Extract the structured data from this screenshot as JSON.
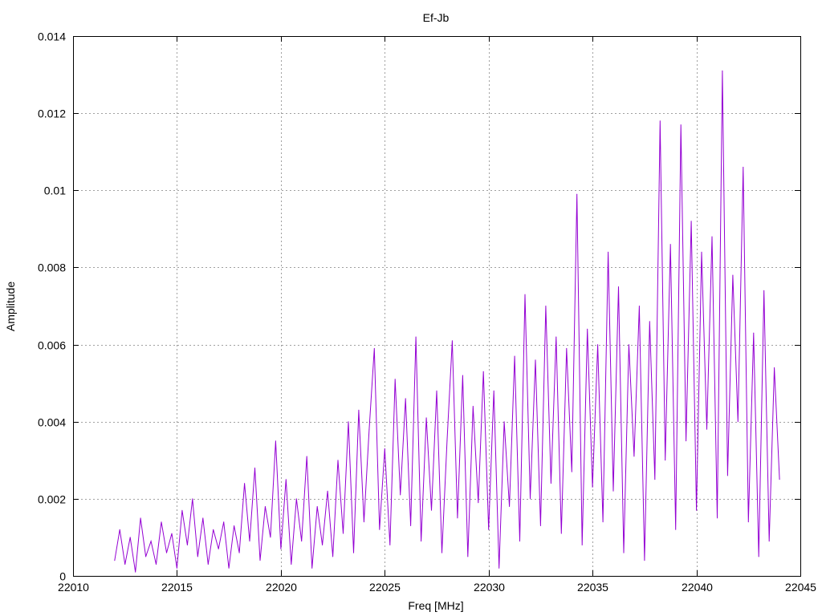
{
  "chart_data": {
    "type": "line",
    "title": "Ef-Jb",
    "xlabel": "Freq [MHz]",
    "ylabel": "Amplitude",
    "xlim": [
      22010,
      22045
    ],
    "ylim": [
      0,
      0.014
    ],
    "grid": true,
    "xticks": [
      22010,
      22015,
      22020,
      22025,
      22030,
      22035,
      22040,
      22045
    ],
    "xtick_labels": [
      "22010",
      "22015",
      "22020",
      "22025",
      "22030",
      "22035",
      "22040",
      "22045"
    ],
    "yticks": [
      0,
      0.002,
      0.004,
      0.006,
      0.008,
      0.01,
      0.012,
      0.014
    ],
    "ytick_labels": [
      "0",
      "0.002",
      "0.004",
      "0.006",
      "0.008",
      "0.01",
      "0.012",
      "0.014"
    ],
    "series": [
      {
        "name": "Ef-Jb",
        "color": "#9400d3",
        "x_start": 22012,
        "x_step": 0.25,
        "values": [
          0.0004,
          0.0012,
          0.0003,
          0.001,
          0.0001,
          0.0015,
          0.0005,
          0.0009,
          0.0003,
          0.0014,
          0.0006,
          0.0011,
          0.0002,
          0.0017,
          0.0008,
          0.002,
          0.0005,
          0.0015,
          0.0003,
          0.0012,
          0.0007,
          0.0014,
          0.0002,
          0.0013,
          0.0006,
          0.0024,
          0.0009,
          0.0028,
          0.0004,
          0.0018,
          0.001,
          0.0035,
          0.0007,
          0.0025,
          0.0003,
          0.002,
          0.0009,
          0.0031,
          0.0002,
          0.0018,
          0.0008,
          0.0022,
          0.0005,
          0.003,
          0.0011,
          0.004,
          0.0006,
          0.0043,
          0.0014,
          0.0038,
          0.0059,
          0.0012,
          0.0033,
          0.0008,
          0.0051,
          0.0021,
          0.0046,
          0.0013,
          0.0062,
          0.0009,
          0.0041,
          0.0017,
          0.0048,
          0.0006,
          0.0035,
          0.0061,
          0.0015,
          0.0052,
          0.0005,
          0.0044,
          0.0019,
          0.0053,
          0.0012,
          0.0048,
          0.0002,
          0.004,
          0.0018,
          0.0057,
          0.0009,
          0.0073,
          0.002,
          0.0056,
          0.0013,
          0.007,
          0.0024,
          0.0062,
          0.0011,
          0.0059,
          0.0027,
          0.0099,
          0.0008,
          0.0064,
          0.0023,
          0.006,
          0.0014,
          0.0084,
          0.0022,
          0.0075,
          0.0006,
          0.006,
          0.0031,
          0.007,
          0.0004,
          0.0066,
          0.0025,
          0.0118,
          0.003,
          0.0086,
          0.0012,
          0.0117,
          0.0035,
          0.0092,
          0.0017,
          0.0084,
          0.0038,
          0.0088,
          0.0015,
          0.0131,
          0.0026,
          0.0078,
          0.004,
          0.0106,
          0.0014,
          0.0063,
          0.0005,
          0.0074,
          0.0009,
          0.0054,
          0.0025
        ]
      }
    ]
  }
}
